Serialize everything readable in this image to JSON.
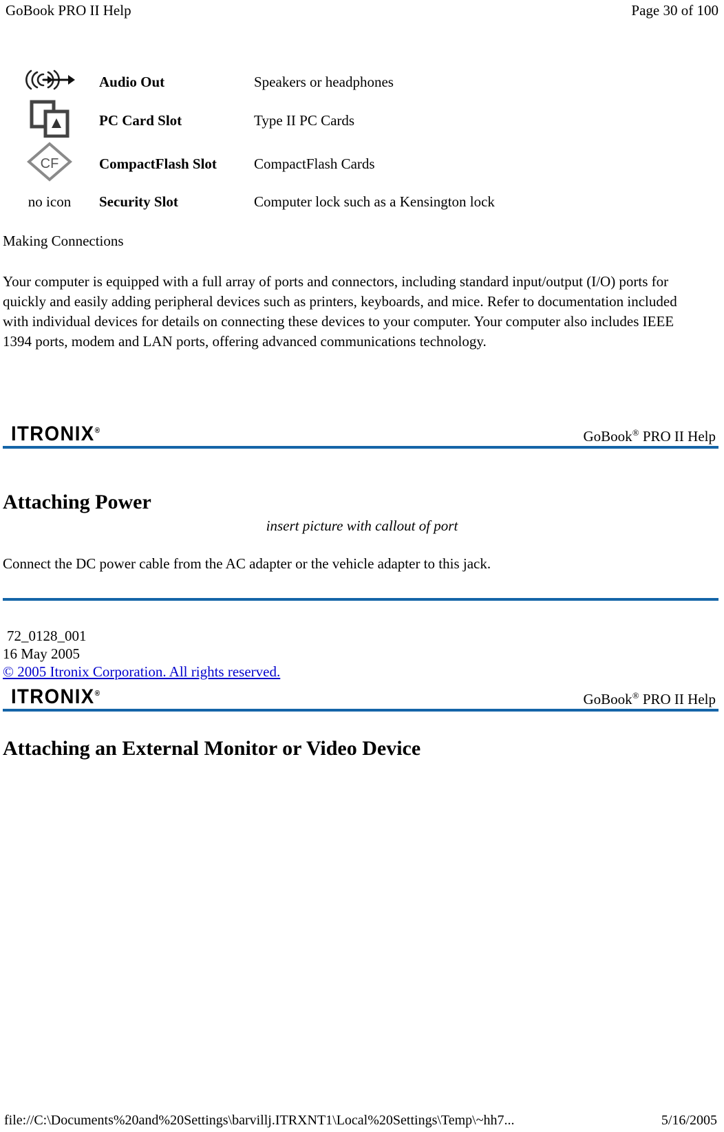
{
  "print_header": {
    "title": "GoBook PRO II Help",
    "page_label": "Page 30 of 100"
  },
  "spec_table": {
    "rows": [
      {
        "icon": "audio-out-icon",
        "icon_label": "",
        "name": "Audio Out",
        "description": "Speakers or headphones"
      },
      {
        "icon": "pc-card-slot-icon",
        "icon_label": "",
        "name": "PC Card Slot",
        "description": "Type II PC Cards"
      },
      {
        "icon": "compactflash-slot-icon",
        "icon_label": "CF",
        "name": "CompactFlash Slot",
        "description": "CompactFlash Cards"
      },
      {
        "icon": "no-icon-placeholder",
        "icon_label": "no icon",
        "name": "Security Slot",
        "description": "Computer lock such as a Kensington lock"
      }
    ]
  },
  "making_connections": {
    "heading": "Making Connections",
    "paragraph": "Your computer is equipped with a full array of ports and connectors, including standard input/output (I/O) ports for quickly and easily adding peripheral devices such as printers, keyboards, and mice. Refer to documentation included with individual devices for details on connecting these devices to your computer. Your computer also includes IEEE 1394 ports, modem and LAN ports, offering advanced communications technology."
  },
  "banner_one": {
    "logo_text": "ITRONIX",
    "logo_mark": "®",
    "label_prefix": "GoBook",
    "label_mark": "®",
    "label_suffix": " PRO II Help",
    "rule_color": "#1565a8"
  },
  "attaching_power": {
    "heading": "Attaching Power",
    "placeholder_note": "insert picture with callout of port",
    "body": "Connect the DC power cable from the AC adapter or the vehicle adapter to this jack."
  },
  "doc_meta": {
    "doc_number": "72_0128_001",
    "date": "16 May 2005",
    "copyright": "© 2005 Itronix Corporation.  All rights reserved."
  },
  "banner_two": {
    "logo_text": "ITRONIX",
    "logo_mark": "®",
    "label_prefix": "GoBook",
    "label_mark": "®",
    "label_suffix": " PRO II Help",
    "rule_color": "#1565a8"
  },
  "attaching_monitor": {
    "heading": "Attaching an External Monitor or Video Device"
  },
  "print_footer": {
    "path": "file://C:\\Documents%20and%20Settings\\barvillj.ITRXNT1\\Local%20Settings\\Temp\\~hh7...",
    "date": "5/16/2005"
  }
}
